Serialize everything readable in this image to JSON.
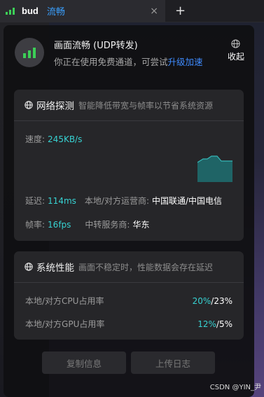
{
  "tab": {
    "app_name": "bud",
    "status": "流畅",
    "close_glyph": "×",
    "add_glyph": "+"
  },
  "header": {
    "title": "画面流畅 (UDP转发)",
    "subtitle_prefix": "你正在使用免费通道，可尝试",
    "upgrade_link": "升级加速",
    "collapse_label": "收起"
  },
  "network": {
    "title": "网络探测",
    "description": "智能降低带宽与帧率以节省系统资源",
    "speed_label": "速度:",
    "speed_value": "245KB/s",
    "latency_label": "延迟:",
    "latency_value": "114ms",
    "carrier_label": "本地/对方运营商:",
    "carrier_value": "中国联通/中国电信",
    "fps_label": "帧率:",
    "fps_value": "16fps",
    "relay_label": "中转服务商:",
    "relay_value": "华东"
  },
  "performance": {
    "title": "系统性能",
    "description": "画面不稳定时，性能数据会存在延迟",
    "cpu_label": "本地/对方CPU占用率",
    "cpu_local": "20%",
    "cpu_remote": "/23%",
    "gpu_label": "本地/对方GPU占用率",
    "gpu_local": "12%",
    "gpu_remote": "/5%"
  },
  "buttons": {
    "copy": "复制信息",
    "upload": "上传日志"
  },
  "watermark": "CSDN @YIN_尹",
  "colors": {
    "accent_green": "#3ccf57",
    "accent_cyan": "#37d2d2",
    "link_blue": "#3f8cff"
  }
}
